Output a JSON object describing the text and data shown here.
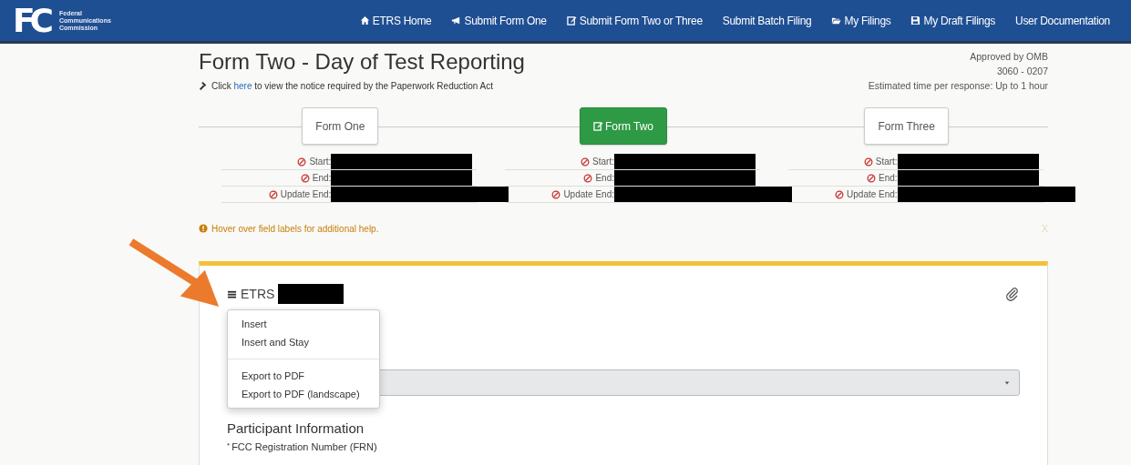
{
  "navbar": {
    "logo_mark": "FC",
    "logo_text": [
      "Federal",
      "Communications",
      "Commission"
    ],
    "items": [
      {
        "label": "ETRS Home"
      },
      {
        "label": "Submit Form One"
      },
      {
        "label": "Submit Form Two or Three"
      },
      {
        "label": "Submit Batch Filing"
      },
      {
        "label": "My Filings"
      },
      {
        "label": "My Draft Filings"
      },
      {
        "label": "User Documentation"
      }
    ]
  },
  "header": {
    "title": "Form Two - Day of Test Reporting",
    "notice_before": "Click",
    "notice_link": "here",
    "notice_after": "to view the notice required by the Paperwork Reduction Act",
    "approval": [
      "Approved by OMB",
      "3060 - 0207",
      "Estimated time per response: Up to 1 hour"
    ]
  },
  "steps": [
    {
      "label": "Form One",
      "selected": false,
      "dates": [
        "Start:",
        "End:",
        "Update End:"
      ]
    },
    {
      "label": "Form Two",
      "selected": true,
      "dates": [
        "Start:",
        "End:",
        "Update End:"
      ]
    },
    {
      "label": "Form Three",
      "selected": false,
      "dates": [
        "Start:",
        "End:",
        "Update End:"
      ]
    }
  ],
  "alert": {
    "text": "Hover over field labels for additional help.",
    "dismiss": "X"
  },
  "card": {
    "title": "ETRS",
    "menu": [
      [
        "Insert",
        "Insert and Stay"
      ],
      [
        "Export to PDF",
        "Export to PDF (landscape)"
      ]
    ],
    "section": "Participant Information",
    "field_label": "FCC Registration Number (FRN)",
    "required_mark": "*"
  }
}
